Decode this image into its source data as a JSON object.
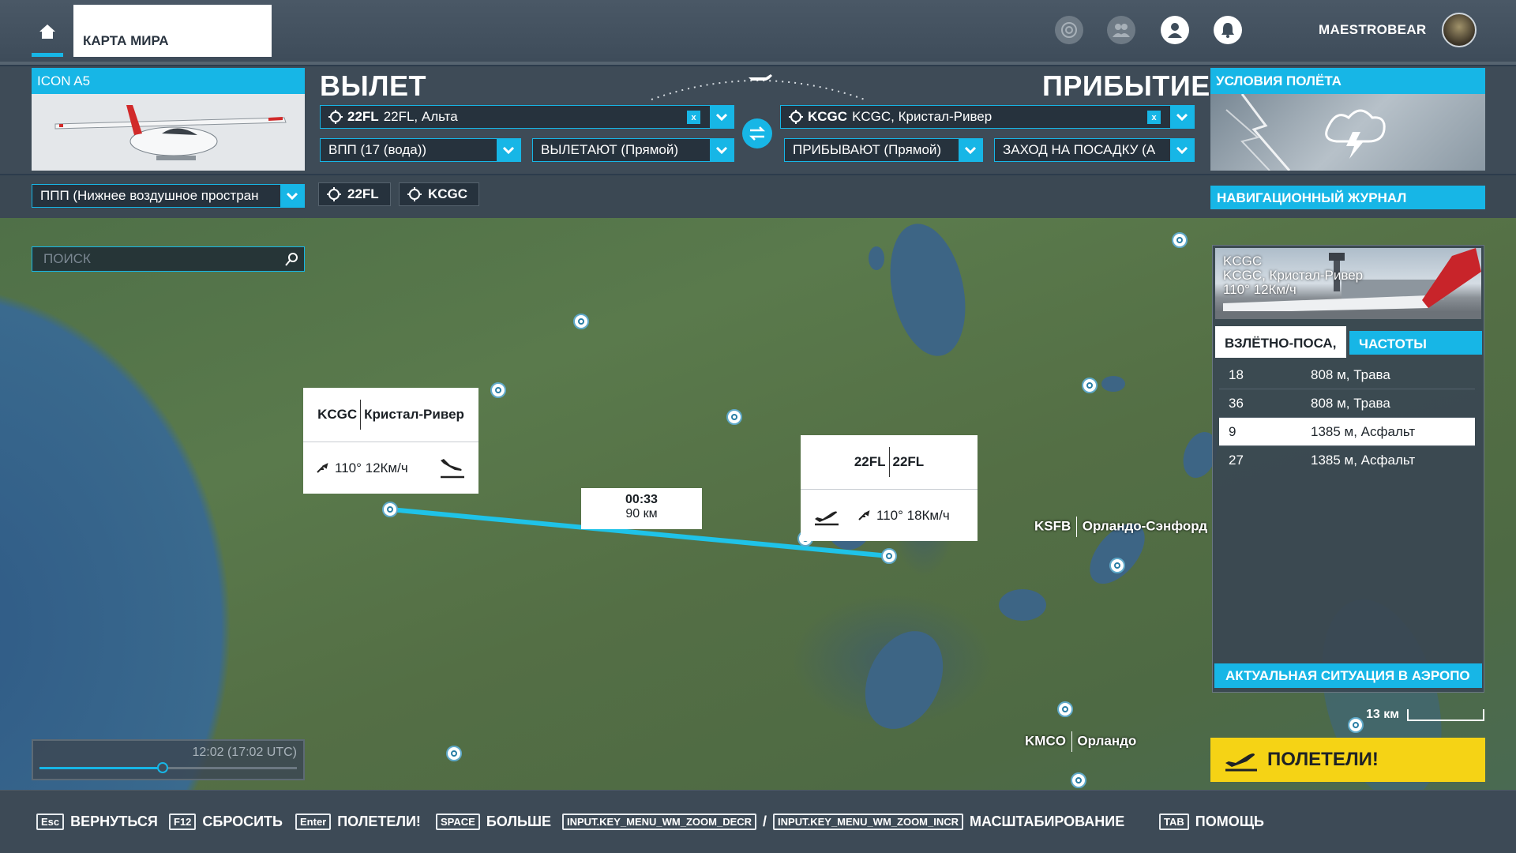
{
  "nav": {
    "world_map_tab": "КАРТА МИРА",
    "username": "MAESTROBEAR"
  },
  "aircraft": {
    "name": "ICON A5"
  },
  "departure": {
    "title": "ВЫЛЕТ",
    "airport_code": "22FL",
    "airport_name": "22FL, Альта",
    "runway": "ВПП (17 (вода))",
    "procedure": "ВЫЛЕТАЮТ (Прямой)"
  },
  "arrival": {
    "title": "ПРИБЫТИЕ",
    "airport_code": "KCGC",
    "airport_name": "KCGC, Кристал-Ривер",
    "procedure": "ПРИБЫВАЮТ (Прямой)",
    "approach": "ЗАХОД НА ПОСАДКУ (А"
  },
  "flight_conditions": {
    "title": "УСЛОВИЯ ПОЛЁТА"
  },
  "routing": {
    "flight_rules": "ППП (Нижнее воздушное простран",
    "chip_dep": "22FL",
    "chip_arr": "KCGC"
  },
  "navlog_label": "НАВИГАЦИОННЫЙ ЖУРНАЛ",
  "search": {
    "placeholder": "ПОИСК"
  },
  "map": {
    "arr_popup": {
      "code": "KCGC",
      "name": "Кристал-Ривер",
      "wind": "110° 12Км/ч"
    },
    "dep_popup": {
      "code": "22FL",
      "name": "22FL",
      "wind": "110° 18Км/ч"
    },
    "leg_time": "00:33",
    "leg_distance": "90 км",
    "labels": [
      {
        "code": "KSFB",
        "name": "Орландо-Сэнфорд"
      },
      {
        "code": "KMCO",
        "name": "Орландо"
      }
    ],
    "scale": "13 км",
    "time": "12:02 (17:02 UTC)",
    "time_progress": 0.48
  },
  "airport_info": {
    "code": "KCGC",
    "name": "KCGC, Кристал-Ривер",
    "wind": "110° 12Км/ч",
    "tab_runways": "ВЗЛЁТНО-ПОСА,",
    "tab_frequencies": "ЧАСТОТЫ",
    "runways": [
      {
        "id": "18",
        "info": "808 м, Трава"
      },
      {
        "id": "36",
        "info": "808 м, Трава"
      },
      {
        "id": "9",
        "info": "1385 м, Асфальт"
      },
      {
        "id": "27",
        "info": "1385 м, Асфальт"
      }
    ],
    "live_button": "АКТУАЛЬНАЯ СИТУАЦИЯ В АЭРОПО"
  },
  "fly_button": "ПОЛЕТЕЛИ!",
  "hints": {
    "back_key": "Esc",
    "back": "ВЕРНУТЬСЯ",
    "reset_key": "F12",
    "reset": "СБРОСИТЬ",
    "fly_key": "Enter",
    "fly": "ПОЛЕТЕЛИ!",
    "more_key": "SPACE",
    "more": "БОЛЬШЕ",
    "zoom_dec_key": "INPUT.KEY_MENU_WM_ZOOM_DECR",
    "zoom_sep": "/",
    "zoom_inc_key": "INPUT.KEY_MENU_WM_ZOOM_INCR",
    "zoom": "МАСШТАБИРОВАНИЕ",
    "help_key": "TAB",
    "help": "ПОМОЩЬ"
  },
  "colors": {
    "accent": "#17b6e6",
    "fly_button": "#f5d315",
    "route": "#1fc3e8"
  }
}
